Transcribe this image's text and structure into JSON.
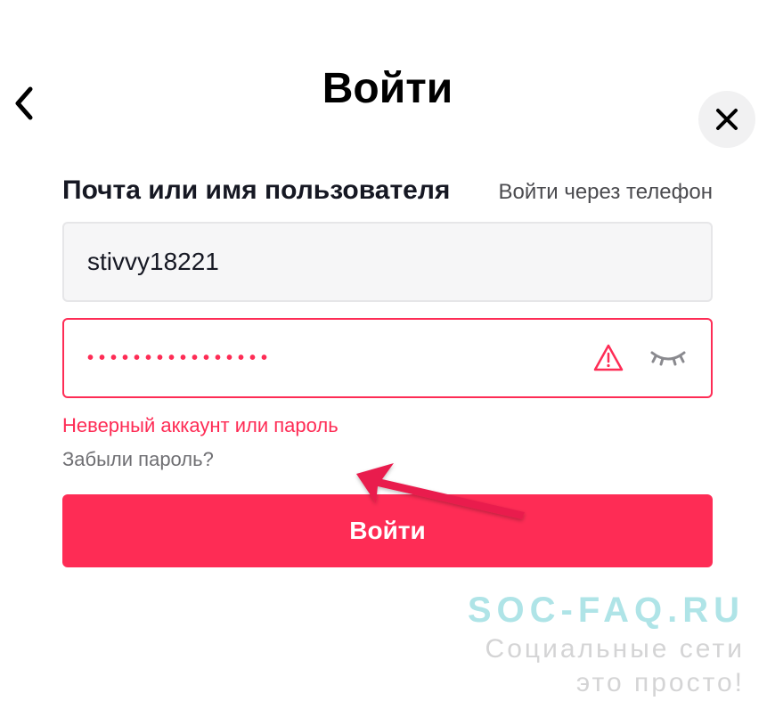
{
  "header": {
    "title": "Войти"
  },
  "form": {
    "username_label": "Почта или имя пользователя",
    "alt_login_label": "Войти через телефон",
    "username_value": "stivvy18221",
    "password_dots": "••••••••••••••••",
    "error_message": "Неверный аккаунт или пароль",
    "forgot_label": "Забыли пароль?",
    "submit_label": "Войти"
  },
  "watermark": {
    "line1": "SOC-FAQ.RU",
    "line2": "Социальные сети",
    "line3": "это просто!"
  }
}
